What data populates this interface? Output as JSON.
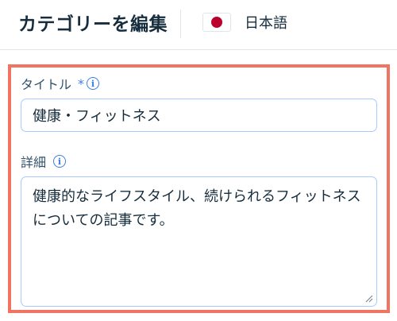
{
  "header": {
    "title": "カテゴリーを編集",
    "language": {
      "label": "日本語",
      "flag_icon": "japan-flag-icon"
    }
  },
  "form": {
    "title_field": {
      "label": "タイトル",
      "required_mark": "*",
      "info_icon": "info-icon",
      "value": "健康・フィットネス"
    },
    "description_field": {
      "label": "詳細",
      "info_icon": "info-icon",
      "value": "健康的なライフスタイル、続けられるフィットネスについての記事です。"
    }
  },
  "colors": {
    "highlight_border": "#f07461",
    "accent": "#3b7ee8",
    "input_border": "#a8caff",
    "flag_red": "#bc002d"
  }
}
